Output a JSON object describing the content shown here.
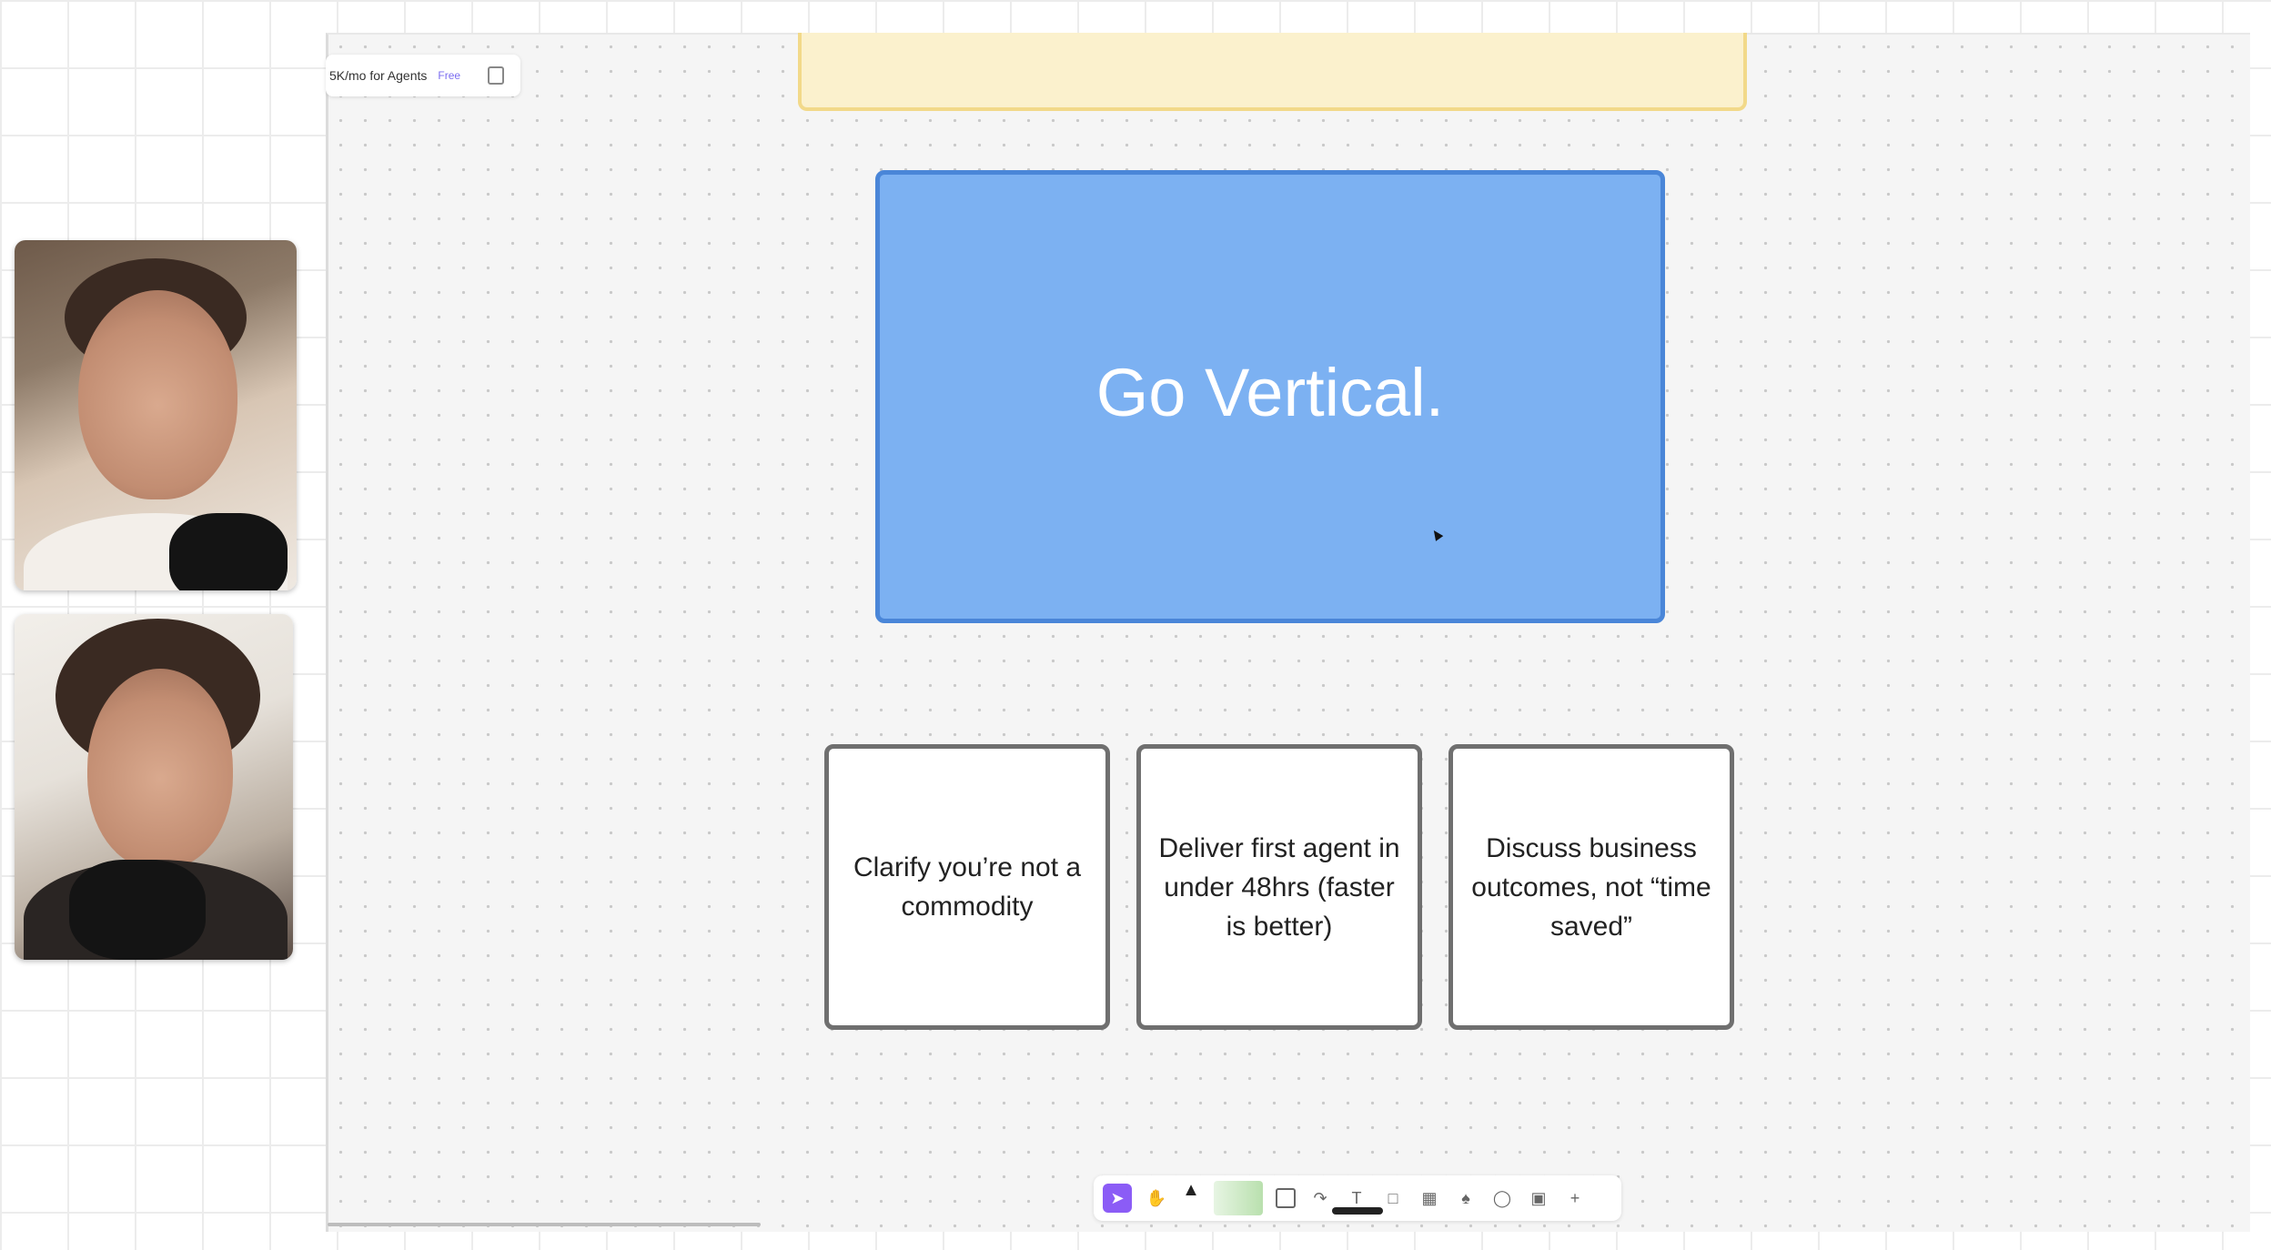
{
  "board": {
    "header_title": "5K/mo for Agents",
    "header_badge": "Free",
    "header_icon": "duplicate-icon"
  },
  "main_card": {
    "title": "Go Vertical.",
    "color": "#7cb1f2",
    "border_color": "#4a86d8"
  },
  "note_color": "#fbf1cd",
  "cards": [
    {
      "text": "Clarify you’re not a commodity"
    },
    {
      "text": "Deliver first agent in under 48hrs (faster is better)"
    },
    {
      "text": "Discuss business outcomes, not “time saved”"
    }
  ],
  "toolbar": {
    "accent": "#8b5cf6",
    "tools": [
      "select-icon",
      "hand-icon",
      "pen-icon",
      "highlighter-swatch",
      "shape-icon",
      "connector-icon",
      "text-icon",
      "sticky-note-icon",
      "table-icon",
      "stamp-icon",
      "comment-icon",
      "apps-icon",
      "add-icon"
    ]
  },
  "participants": [
    {
      "label": "participant-1-video"
    },
    {
      "label": "participant-2-video"
    }
  ]
}
